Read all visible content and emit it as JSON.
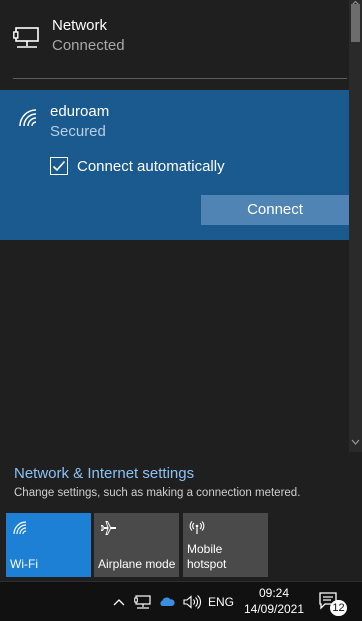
{
  "network": {
    "name": "Network",
    "status": "Connected",
    "icon": "ethernet-network-icon"
  },
  "wifi": {
    "name": "eduroam",
    "status": "Secured",
    "connect_auto_label": "Connect automatically",
    "connect_auto_checked": true,
    "connect_button": "Connect",
    "icon": "wifi-secured-icon"
  },
  "settings": {
    "link": "Network & Internet settings",
    "description": "Change settings, such as making a connection metered."
  },
  "tiles": [
    {
      "label": "Wi-Fi",
      "icon": "wifi-icon",
      "active": true
    },
    {
      "label": "Airplane mode",
      "icon": "airplane-icon",
      "active": false
    },
    {
      "label_line1": "Mobile",
      "label_line2": "hotspot",
      "icon": "hotspot-icon",
      "active": false
    }
  ],
  "taskbar": {
    "language": "ENG",
    "time": "09:24",
    "date": "14/09/2021",
    "notification_count": "12"
  },
  "colors": {
    "accent": "#1d80d4",
    "selected_panel": "#1a5a8e",
    "link": "#8bc2f4"
  }
}
